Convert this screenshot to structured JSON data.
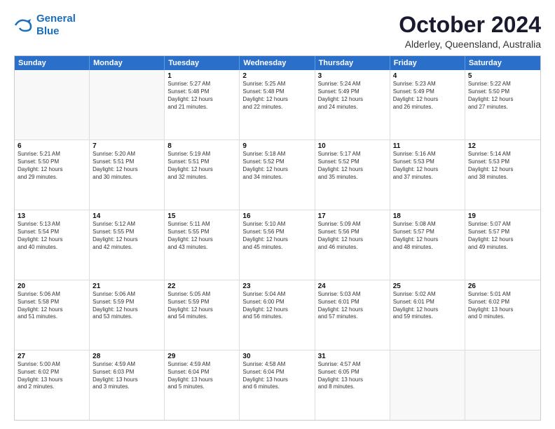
{
  "logo": {
    "line1": "General",
    "line2": "Blue"
  },
  "header": {
    "month": "October 2024",
    "location": "Alderley, Queensland, Australia"
  },
  "days": [
    "Sunday",
    "Monday",
    "Tuesday",
    "Wednesday",
    "Thursday",
    "Friday",
    "Saturday"
  ],
  "rows": [
    [
      {
        "day": "",
        "lines": []
      },
      {
        "day": "",
        "lines": []
      },
      {
        "day": "1",
        "lines": [
          "Sunrise: 5:27 AM",
          "Sunset: 5:48 PM",
          "Daylight: 12 hours",
          "and 21 minutes."
        ]
      },
      {
        "day": "2",
        "lines": [
          "Sunrise: 5:25 AM",
          "Sunset: 5:48 PM",
          "Daylight: 12 hours",
          "and 22 minutes."
        ]
      },
      {
        "day": "3",
        "lines": [
          "Sunrise: 5:24 AM",
          "Sunset: 5:49 PM",
          "Daylight: 12 hours",
          "and 24 minutes."
        ]
      },
      {
        "day": "4",
        "lines": [
          "Sunrise: 5:23 AM",
          "Sunset: 5:49 PM",
          "Daylight: 12 hours",
          "and 26 minutes."
        ]
      },
      {
        "day": "5",
        "lines": [
          "Sunrise: 5:22 AM",
          "Sunset: 5:50 PM",
          "Daylight: 12 hours",
          "and 27 minutes."
        ]
      }
    ],
    [
      {
        "day": "6",
        "lines": [
          "Sunrise: 5:21 AM",
          "Sunset: 5:50 PM",
          "Daylight: 12 hours",
          "and 29 minutes."
        ]
      },
      {
        "day": "7",
        "lines": [
          "Sunrise: 5:20 AM",
          "Sunset: 5:51 PM",
          "Daylight: 12 hours",
          "and 30 minutes."
        ]
      },
      {
        "day": "8",
        "lines": [
          "Sunrise: 5:19 AM",
          "Sunset: 5:51 PM",
          "Daylight: 12 hours",
          "and 32 minutes."
        ]
      },
      {
        "day": "9",
        "lines": [
          "Sunrise: 5:18 AM",
          "Sunset: 5:52 PM",
          "Daylight: 12 hours",
          "and 34 minutes."
        ]
      },
      {
        "day": "10",
        "lines": [
          "Sunrise: 5:17 AM",
          "Sunset: 5:52 PM",
          "Daylight: 12 hours",
          "and 35 minutes."
        ]
      },
      {
        "day": "11",
        "lines": [
          "Sunrise: 5:16 AM",
          "Sunset: 5:53 PM",
          "Daylight: 12 hours",
          "and 37 minutes."
        ]
      },
      {
        "day": "12",
        "lines": [
          "Sunrise: 5:14 AM",
          "Sunset: 5:53 PM",
          "Daylight: 12 hours",
          "and 38 minutes."
        ]
      }
    ],
    [
      {
        "day": "13",
        "lines": [
          "Sunrise: 5:13 AM",
          "Sunset: 5:54 PM",
          "Daylight: 12 hours",
          "and 40 minutes."
        ]
      },
      {
        "day": "14",
        "lines": [
          "Sunrise: 5:12 AM",
          "Sunset: 5:55 PM",
          "Daylight: 12 hours",
          "and 42 minutes."
        ]
      },
      {
        "day": "15",
        "lines": [
          "Sunrise: 5:11 AM",
          "Sunset: 5:55 PM",
          "Daylight: 12 hours",
          "and 43 minutes."
        ]
      },
      {
        "day": "16",
        "lines": [
          "Sunrise: 5:10 AM",
          "Sunset: 5:56 PM",
          "Daylight: 12 hours",
          "and 45 minutes."
        ]
      },
      {
        "day": "17",
        "lines": [
          "Sunrise: 5:09 AM",
          "Sunset: 5:56 PM",
          "Daylight: 12 hours",
          "and 46 minutes."
        ]
      },
      {
        "day": "18",
        "lines": [
          "Sunrise: 5:08 AM",
          "Sunset: 5:57 PM",
          "Daylight: 12 hours",
          "and 48 minutes."
        ]
      },
      {
        "day": "19",
        "lines": [
          "Sunrise: 5:07 AM",
          "Sunset: 5:57 PM",
          "Daylight: 12 hours",
          "and 49 minutes."
        ]
      }
    ],
    [
      {
        "day": "20",
        "lines": [
          "Sunrise: 5:06 AM",
          "Sunset: 5:58 PM",
          "Daylight: 12 hours",
          "and 51 minutes."
        ]
      },
      {
        "day": "21",
        "lines": [
          "Sunrise: 5:06 AM",
          "Sunset: 5:59 PM",
          "Daylight: 12 hours",
          "and 53 minutes."
        ]
      },
      {
        "day": "22",
        "lines": [
          "Sunrise: 5:05 AM",
          "Sunset: 5:59 PM",
          "Daylight: 12 hours",
          "and 54 minutes."
        ]
      },
      {
        "day": "23",
        "lines": [
          "Sunrise: 5:04 AM",
          "Sunset: 6:00 PM",
          "Daylight: 12 hours",
          "and 56 minutes."
        ]
      },
      {
        "day": "24",
        "lines": [
          "Sunrise: 5:03 AM",
          "Sunset: 6:01 PM",
          "Daylight: 12 hours",
          "and 57 minutes."
        ]
      },
      {
        "day": "25",
        "lines": [
          "Sunrise: 5:02 AM",
          "Sunset: 6:01 PM",
          "Daylight: 12 hours",
          "and 59 minutes."
        ]
      },
      {
        "day": "26",
        "lines": [
          "Sunrise: 5:01 AM",
          "Sunset: 6:02 PM",
          "Daylight: 13 hours",
          "and 0 minutes."
        ]
      }
    ],
    [
      {
        "day": "27",
        "lines": [
          "Sunrise: 5:00 AM",
          "Sunset: 6:02 PM",
          "Daylight: 13 hours",
          "and 2 minutes."
        ]
      },
      {
        "day": "28",
        "lines": [
          "Sunrise: 4:59 AM",
          "Sunset: 6:03 PM",
          "Daylight: 13 hours",
          "and 3 minutes."
        ]
      },
      {
        "day": "29",
        "lines": [
          "Sunrise: 4:59 AM",
          "Sunset: 6:04 PM",
          "Daylight: 13 hours",
          "and 5 minutes."
        ]
      },
      {
        "day": "30",
        "lines": [
          "Sunrise: 4:58 AM",
          "Sunset: 6:04 PM",
          "Daylight: 13 hours",
          "and 6 minutes."
        ]
      },
      {
        "day": "31",
        "lines": [
          "Sunrise: 4:57 AM",
          "Sunset: 6:05 PM",
          "Daylight: 13 hours",
          "and 8 minutes."
        ]
      },
      {
        "day": "",
        "lines": []
      },
      {
        "day": "",
        "lines": []
      }
    ]
  ]
}
